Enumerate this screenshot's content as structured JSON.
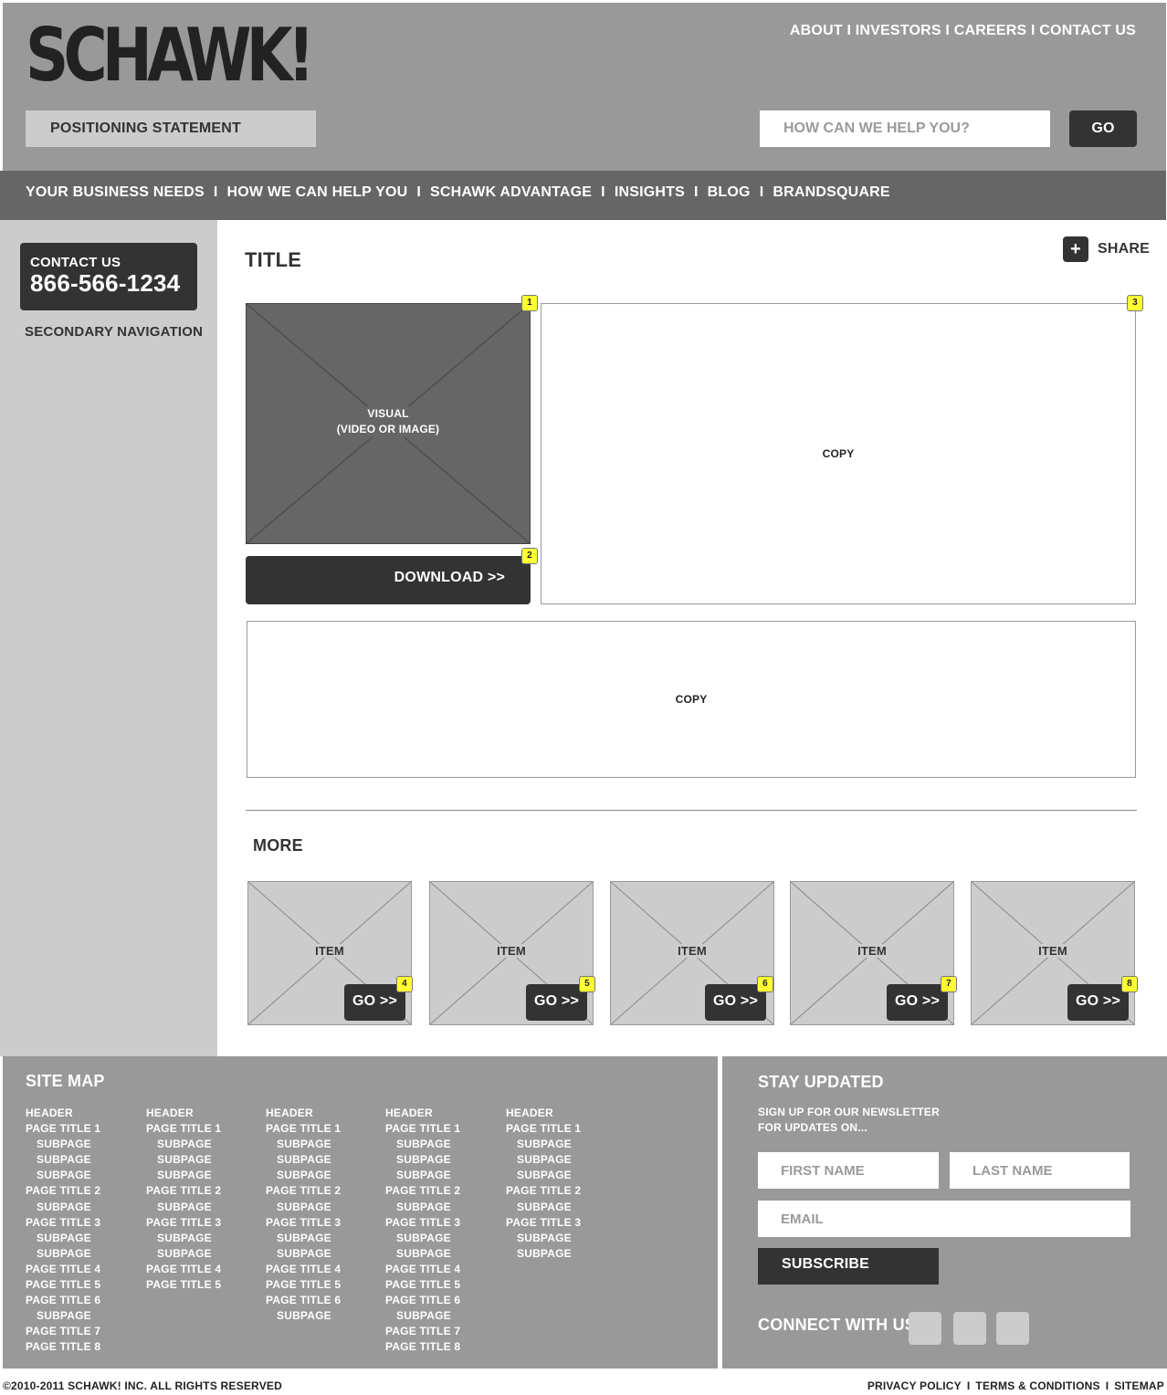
{
  "header": {
    "logo_text": "SCHAWK!",
    "positioning_statement": "POSITIONING STATEMENT",
    "utility_links": [
      "ABOUT",
      "INVESTORS",
      "CAREERS",
      "CONTACT US"
    ],
    "search_placeholder": "HOW CAN WE HELP YOU?",
    "search_button": "GO"
  },
  "main_nav": {
    "items": [
      "YOUR BUSINESS NEEDS",
      "HOW WE CAN HELP YOU",
      "SCHAWK ADVANTAGE",
      "INSIGHTS",
      "BLOG",
      "BRANDSQUARE"
    ]
  },
  "sidebar": {
    "contact_label": "CONTACT US",
    "contact_phone": "866-566-1234",
    "secondary_nav": "SECONDARY NAVIGATION"
  },
  "content": {
    "title": "TITLE",
    "share_icon": "plus-icon",
    "share_label": "SHARE",
    "visual_label_1": "VISUAL",
    "visual_label_2": "(VIDEO OR IMAGE)",
    "download_label": "DOWNLOAD >>",
    "copy_top": "COPY",
    "copy_bottom": "COPY",
    "markers": [
      "1",
      "2",
      "3"
    ],
    "more_title": "MORE",
    "items": [
      {
        "label": "ITEM",
        "go": "GO >>",
        "marker": "4"
      },
      {
        "label": "ITEM",
        "go": "GO >>",
        "marker": "5"
      },
      {
        "label": "ITEM",
        "go": "GO >>",
        "marker": "6"
      },
      {
        "label": "ITEM",
        "go": "GO >>",
        "marker": "7"
      },
      {
        "label": "ITEM",
        "go": "GO >>",
        "marker": "8"
      }
    ]
  },
  "sitemap": {
    "title": "SITE MAP",
    "columns": [
      [
        {
          "text": "HEADER",
          "sub": false
        },
        {
          "text": "PAGE TITLE 1",
          "sub": false
        },
        {
          "text": "SUBPAGE",
          "sub": true
        },
        {
          "text": "SUBPAGE",
          "sub": true
        },
        {
          "text": "SUBPAGE",
          "sub": true
        },
        {
          "text": "PAGE TITLE 2",
          "sub": false
        },
        {
          "text": "SUBPAGE",
          "sub": true
        },
        {
          "text": "PAGE TITLE 3",
          "sub": false
        },
        {
          "text": "SUBPAGE",
          "sub": true
        },
        {
          "text": "SUBPAGE",
          "sub": true
        },
        {
          "text": "PAGE TITLE 4",
          "sub": false
        },
        {
          "text": "PAGE TITLE 5",
          "sub": false
        },
        {
          "text": "PAGE TITLE 6",
          "sub": false
        },
        {
          "text": "SUBPAGE",
          "sub": true
        },
        {
          "text": "PAGE TITLE 7",
          "sub": false
        },
        {
          "text": "PAGE TITLE 8",
          "sub": false
        }
      ],
      [
        {
          "text": "HEADER",
          "sub": false
        },
        {
          "text": "PAGE TITLE 1",
          "sub": false
        },
        {
          "text": "SUBPAGE",
          "sub": true
        },
        {
          "text": "SUBPAGE",
          "sub": true
        },
        {
          "text": "SUBPAGE",
          "sub": true
        },
        {
          "text": "PAGE TITLE 2",
          "sub": false
        },
        {
          "text": "SUBPAGE",
          "sub": true
        },
        {
          "text": "PAGE TITLE 3",
          "sub": false
        },
        {
          "text": "SUBPAGE",
          "sub": true
        },
        {
          "text": "SUBPAGE",
          "sub": true
        },
        {
          "text": "PAGE TITLE 4",
          "sub": false
        },
        {
          "text": "PAGE TITLE 5",
          "sub": false
        }
      ],
      [
        {
          "text": "HEADER",
          "sub": false
        },
        {
          "text": "PAGE TITLE 1",
          "sub": false
        },
        {
          "text": "SUBPAGE",
          "sub": true
        },
        {
          "text": "SUBPAGE",
          "sub": true
        },
        {
          "text": "SUBPAGE",
          "sub": true
        },
        {
          "text": "PAGE TITLE 2",
          "sub": false
        },
        {
          "text": "SUBPAGE",
          "sub": true
        },
        {
          "text": "PAGE TITLE 3",
          "sub": false
        },
        {
          "text": "SUBPAGE",
          "sub": true
        },
        {
          "text": "SUBPAGE",
          "sub": true
        },
        {
          "text": "PAGE TITLE 4",
          "sub": false
        },
        {
          "text": "PAGE TITLE 5",
          "sub": false
        },
        {
          "text": "PAGE TITLE 6",
          "sub": false
        },
        {
          "text": "SUBPAGE",
          "sub": true
        }
      ],
      [
        {
          "text": "HEADER",
          "sub": false
        },
        {
          "text": "PAGE TITLE 1",
          "sub": false
        },
        {
          "text": "SUBPAGE",
          "sub": true
        },
        {
          "text": "SUBPAGE",
          "sub": true
        },
        {
          "text": "SUBPAGE",
          "sub": true
        },
        {
          "text": "PAGE TITLE 2",
          "sub": false
        },
        {
          "text": "SUBPAGE",
          "sub": true
        },
        {
          "text": "PAGE TITLE 3",
          "sub": false
        },
        {
          "text": "SUBPAGE",
          "sub": true
        },
        {
          "text": "SUBPAGE",
          "sub": true
        },
        {
          "text": "PAGE TITLE 4",
          "sub": false
        },
        {
          "text": "PAGE TITLE 5",
          "sub": false
        },
        {
          "text": "PAGE TITLE 6",
          "sub": false
        },
        {
          "text": "SUBPAGE",
          "sub": true
        },
        {
          "text": "PAGE TITLE 7",
          "sub": false
        },
        {
          "text": "PAGE TITLE 8",
          "sub": false
        }
      ],
      [
        {
          "text": "HEADER",
          "sub": false
        },
        {
          "text": "PAGE TITLE 1",
          "sub": false
        },
        {
          "text": "SUBPAGE",
          "sub": true
        },
        {
          "text": "SUBPAGE",
          "sub": true
        },
        {
          "text": "SUBPAGE",
          "sub": true
        },
        {
          "text": "PAGE TITLE 2",
          "sub": false
        },
        {
          "text": "SUBPAGE",
          "sub": true
        },
        {
          "text": "PAGE TITLE 3",
          "sub": false
        },
        {
          "text": "SUBPAGE",
          "sub": true
        },
        {
          "text": "SUBPAGE",
          "sub": true
        }
      ]
    ]
  },
  "stay_updated": {
    "title": "STAY UPDATED",
    "description_line1": "SIGN UP FOR OUR NEWSLETTER",
    "description_line2": "FOR UPDATES ON...",
    "first_name_placeholder": "FIRST NAME",
    "last_name_placeholder": "LAST NAME",
    "email_placeholder": "EMAIL",
    "subscribe_label": "SUBSCRIBE",
    "connect_label": "CONNECT WITH US"
  },
  "footer": {
    "copyright": "©2010-2011 SCHAWK! INC. ALL RIGHTS RESERVED",
    "links": [
      "PRIVACY POLICY",
      "TERMS & CONDITIONS",
      "SITEMAP"
    ]
  }
}
